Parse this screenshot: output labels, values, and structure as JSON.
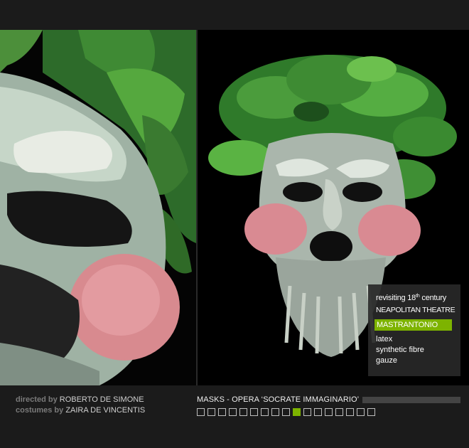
{
  "gallery": {
    "caption": {
      "line1_pre": "revisiting 18",
      "line1_sup": "th",
      "line1_post": " century",
      "line2": "NEAPOLITAN THEATRE",
      "name": "MASTRANTONIO",
      "materials": [
        "latex",
        "synthetic fibre",
        "gauze"
      ]
    },
    "accent_color": "#7db300"
  },
  "footer": {
    "credits": [
      {
        "role": "directed by",
        "name": "ROBERTO DE SIMONE"
      },
      {
        "role": "costumes by",
        "name": "ZAIRA DE VINCENTIS"
      }
    ],
    "title": "MASKS  -  OPERA ‘SOCRATE IMMAGINARIO’",
    "thumbnails": {
      "count": 17,
      "active_index": 9
    }
  }
}
